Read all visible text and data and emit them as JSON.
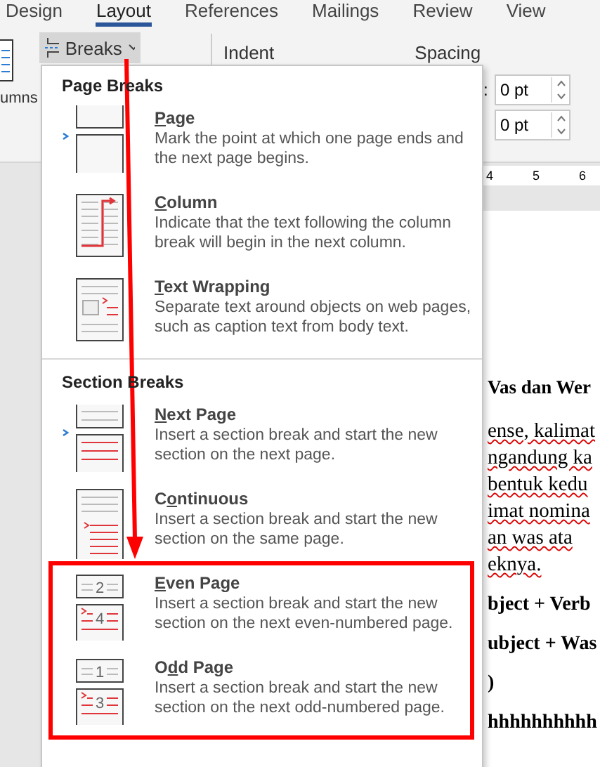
{
  "tabs": [
    {
      "label": "Design",
      "selected": false
    },
    {
      "label": "Layout",
      "selected": true
    },
    {
      "label": "References",
      "selected": false
    },
    {
      "label": "Mailings",
      "selected": false
    },
    {
      "label": "Review",
      "selected": false
    },
    {
      "label": "View",
      "selected": false
    }
  ],
  "ribbon": {
    "columns_label": "umns",
    "breaks_button": "Breaks",
    "indent_label": "Indent",
    "spacing_label": "Spacing",
    "spacing_colon": ":",
    "spacing_fields": [
      "0 pt",
      "0 pt"
    ],
    "ruler": [
      "4",
      "5",
      "6"
    ]
  },
  "document": {
    "heading": "Vas dan Wer",
    "lines": [
      "ense, kalimat",
      "ngandung ka",
      "bentuk kedu",
      "imat nomina",
      "an  was  ata",
      "eknya."
    ],
    "bold_lines": [
      "bject + Verb",
      "ubject + Was",
      ")",
      "hhhhhhhhhh"
    ]
  },
  "menu": {
    "sections": [
      {
        "title": "Page Breaks",
        "items": [
          {
            "kind": "page",
            "key": "P",
            "after": "age",
            "description": "Mark the point at which one page ends and the next page begins."
          },
          {
            "kind": "column",
            "key": "C",
            "after": "olumn",
            "description": "Indicate that the text following the column break will begin in the next column."
          },
          {
            "kind": "text-wrapping",
            "key": "T",
            "after": "ext Wrapping",
            "description": "Separate text around objects on web pages, such as caption text from body text."
          }
        ]
      },
      {
        "title": "Section Breaks",
        "items": [
          {
            "kind": "next-page",
            "key": "N",
            "after": "ext Page",
            "description": "Insert a section break and start the new section on the next page."
          },
          {
            "kind": "continuous",
            "before": "C",
            "key": "o",
            "after": "ntinuous",
            "description": "Insert a section break and start the new section on the same page."
          },
          {
            "kind": "even-page",
            "key": "E",
            "after": "ven Page",
            "description": "Insert a section break and start the new section on the next even-numbered page.",
            "icon_numbers": [
              "2",
              "4"
            ]
          },
          {
            "kind": "odd-page",
            "before": "O",
            "key": "d",
            "after": "d Page",
            "description": "Insert a section break and start the new section on the next odd-numbered page.",
            "icon_numbers": [
              "1",
              "3"
            ]
          }
        ]
      }
    ]
  }
}
